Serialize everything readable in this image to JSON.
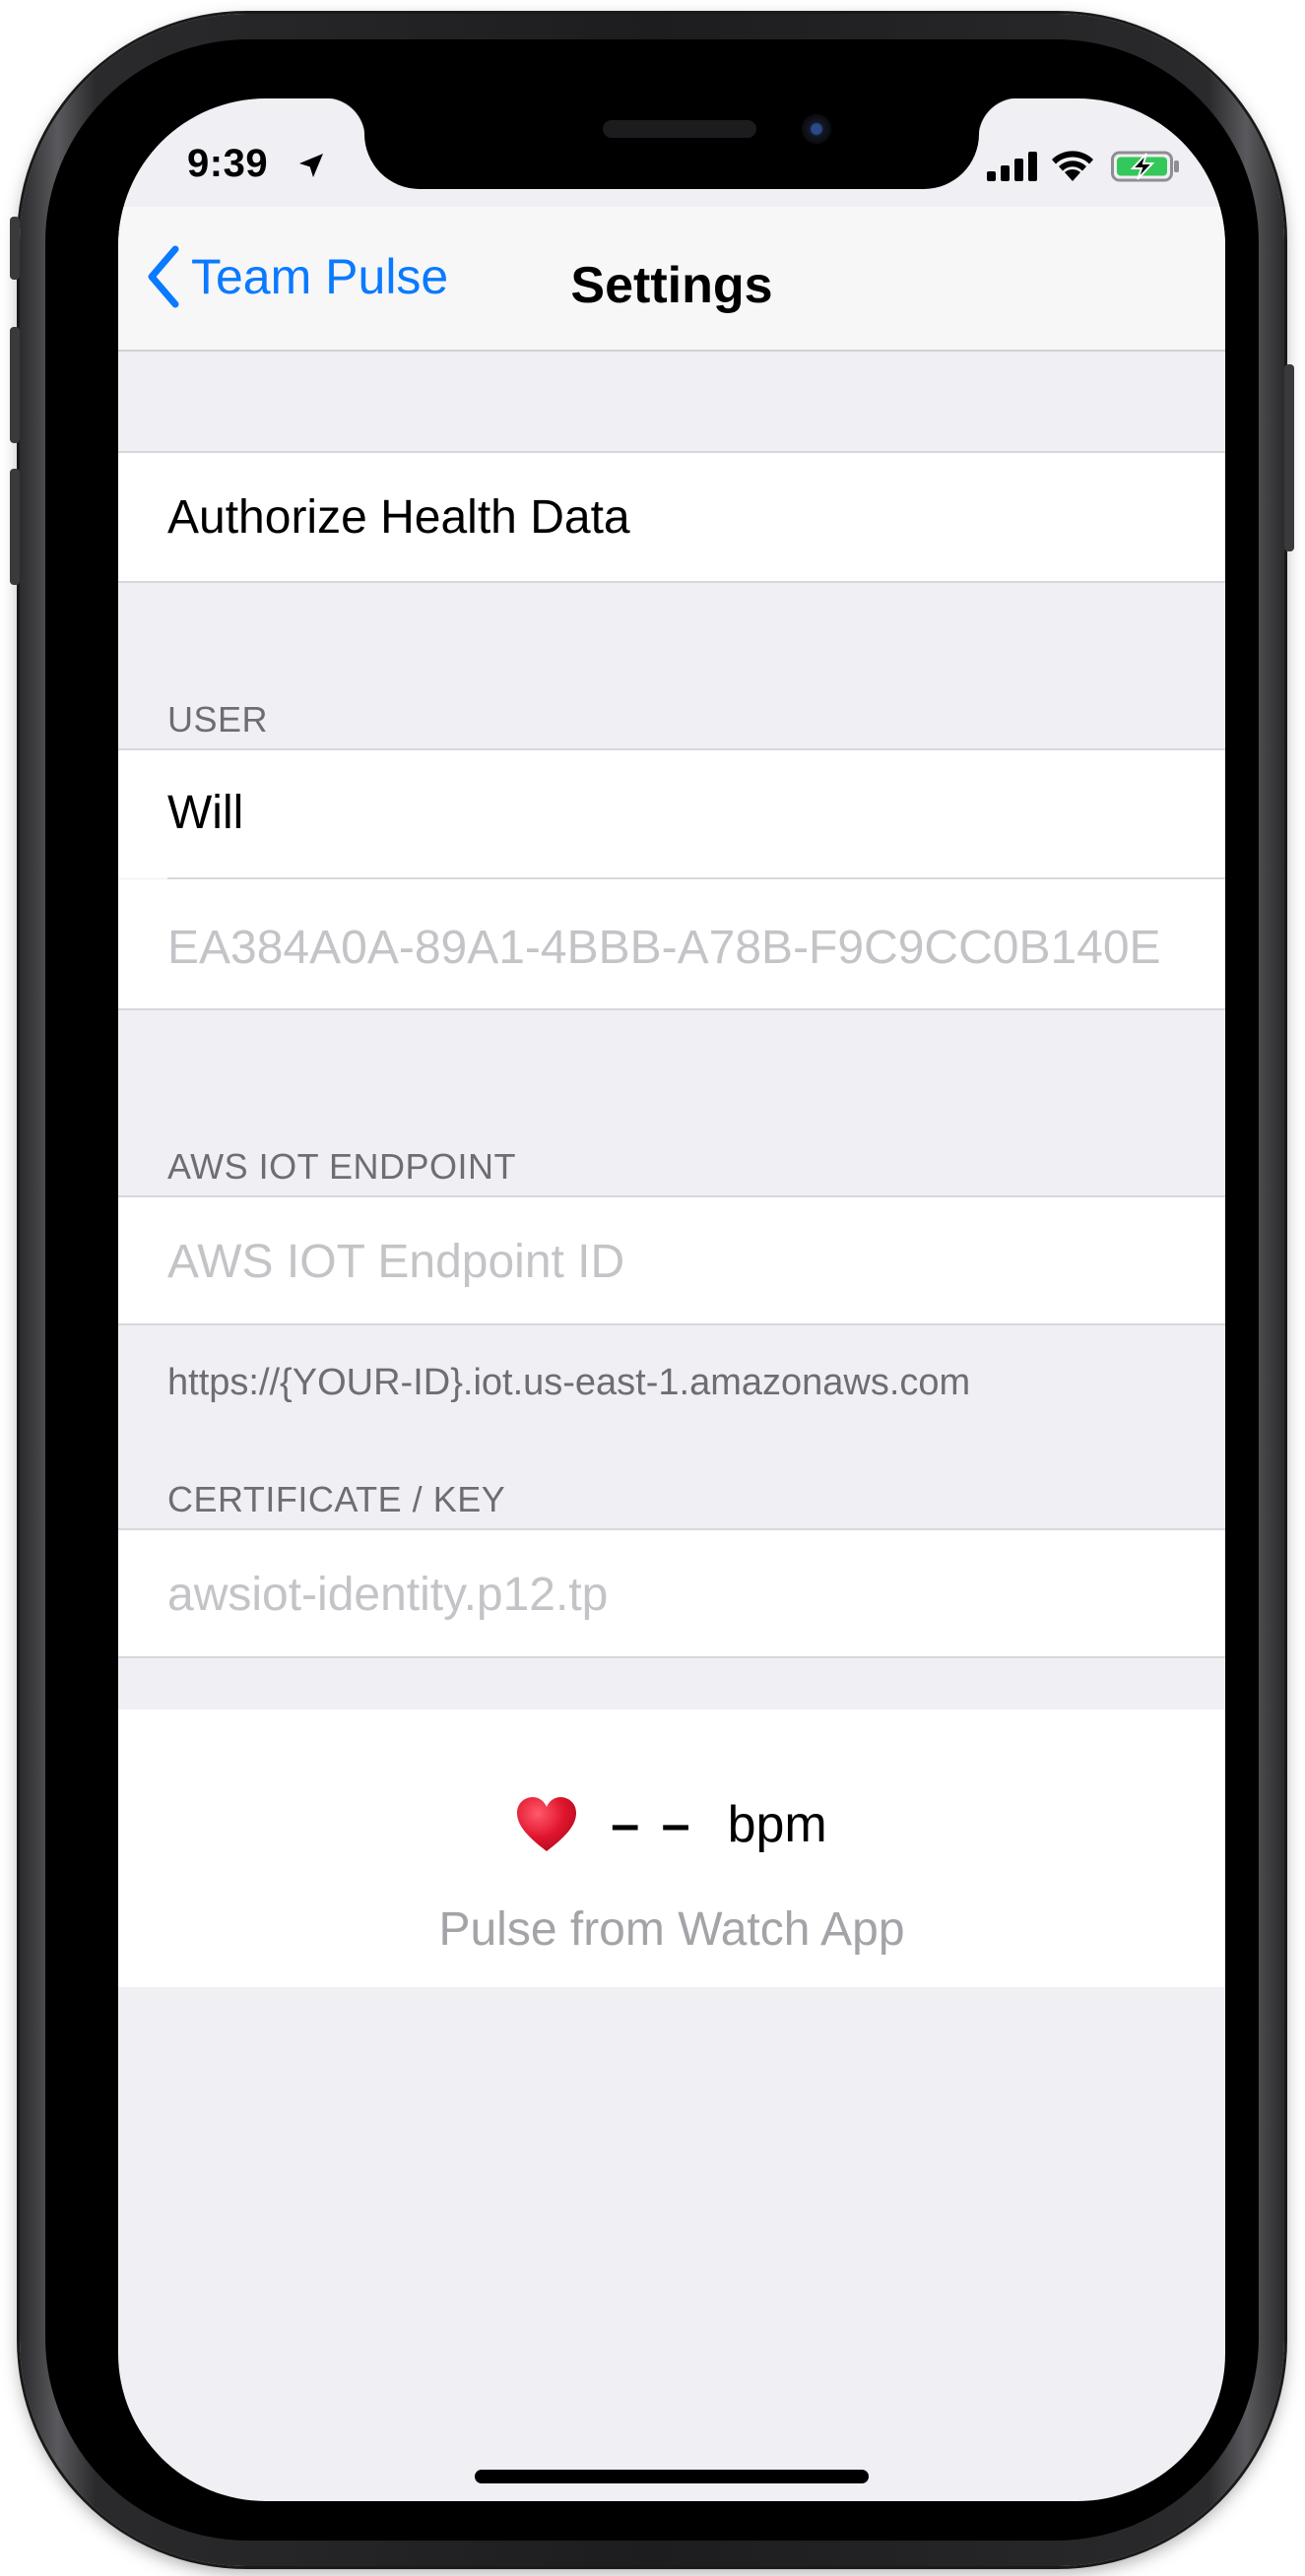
{
  "status_bar": {
    "time": "9:39"
  },
  "nav": {
    "back_label": "Team Pulse",
    "title": "Settings"
  },
  "rows": {
    "authorize_health": "Authorize Health Data"
  },
  "user_section": {
    "header": "USER",
    "name": "Will",
    "device_id": "EA384A0A-89A1-4BBB-A78B-F9C9CC0B140E"
  },
  "aws_section": {
    "header": "AWS IOT ENDPOINT",
    "endpoint_placeholder": "AWS IOT Endpoint ID",
    "endpoint_footer": "https://{YOUR-ID}.iot.us-east-1.amazonaws.com"
  },
  "cert_section": {
    "header": "CERTIFICATE / KEY",
    "file_placeholder": "awsiot-identity.p12.tp"
  },
  "pulse": {
    "value": "– –",
    "unit": "bpm",
    "caption": "Pulse from Watch App"
  },
  "colors": {
    "accent": "#0a7aff",
    "background": "#efeff4",
    "cell": "#ffffff",
    "header_text": "#6d6d72",
    "placeholder_text": "#c4c4c8",
    "heart": "#e0152d",
    "battery_fill": "#34c759"
  },
  "icons": {
    "back": "chevron-left-icon",
    "location": "location-arrow-icon",
    "signal": "cellular-signal-icon",
    "wifi": "wifi-icon",
    "battery": "battery-charging-icon",
    "heart": "heart-icon"
  }
}
